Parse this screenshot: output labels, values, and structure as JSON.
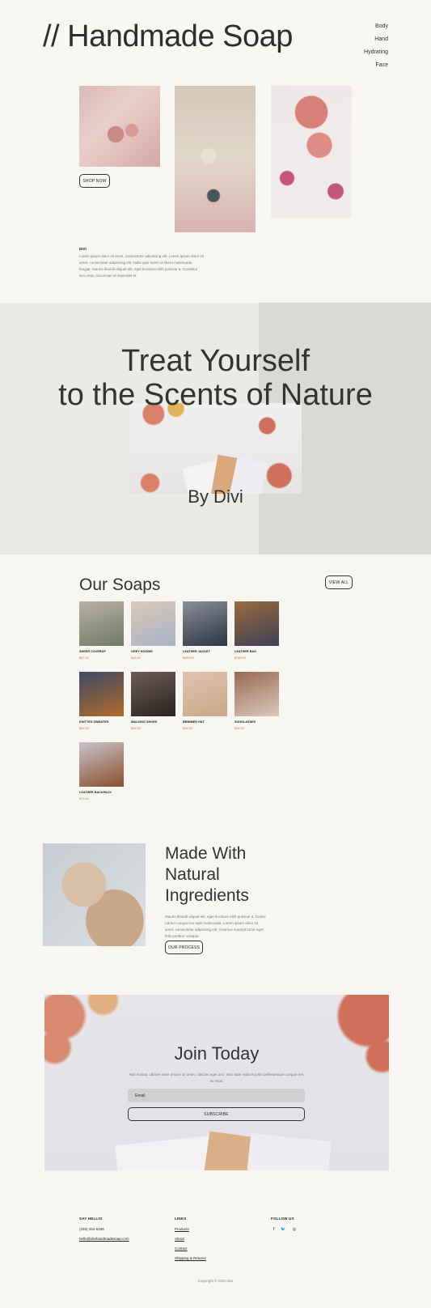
{
  "header": {
    "title": "// Handmade Soap",
    "nav": [
      "Body",
      "Hand",
      "Hydrating",
      "Face"
    ]
  },
  "intro": {
    "shop_button": "SHOP NOW",
    "blurb_title": "DIVI",
    "blurb_text": "Lorem ipsum dolor sit amet, consectetur adipiscing elit. Lorem ipsum dolor sit amet, consectetur adipiscing elit. Nulla quis lorem ut libero malesuada feugiat. Mauris blandit aliquet elit, eget tincidunt nibh pulvinar a. Curabitur arcu erat, accumsan id imperdiet et."
  },
  "hero": {
    "title_line1": "Treat Yourself",
    "title_line2": "to the Scents of Nature",
    "subtitle": "By Divi"
  },
  "soaps": {
    "title": "Our Soaps",
    "view_all": "VIEW ALL",
    "products": [
      {
        "name": "SHEER COVERUP",
        "price": "$57.00",
        "color1": "#6f7a64",
        "color2": "#b8b2a6"
      },
      {
        "name": "GREY HOODIE",
        "price": "$15.00",
        "color1": "#a8b3c6",
        "color2": "#d9c8b8"
      },
      {
        "name": "LEATHER JACKET",
        "price": "$289.00",
        "color1": "#2d3442",
        "color2": "#8a8f99"
      },
      {
        "name": "LEATHER BAG",
        "price": "$765.00",
        "color1": "#3b4256",
        "color2": "#9a6a3f"
      },
      {
        "name": "KNITTED SWEATER",
        "price": "$63.00",
        "color1": "#b26a2a",
        "color2": "#3d4a66"
      },
      {
        "name": "WALKING SHOES",
        "price": "$53.00",
        "color1": "#2a2320",
        "color2": "#6d5c55"
      },
      {
        "name": "BRIMMED HAT",
        "price": "$18.00",
        "color1": "#caa887",
        "color2": "#e2c2b0"
      },
      {
        "name": "SUNGLASSES",
        "price": "$46.00",
        "color1": "#d9c9be",
        "color2": "#9a6a52"
      },
      {
        "name": "LEATHER BACKPACK",
        "price": "$70.00",
        "color1": "#8a4f2c",
        "color2": "#c9c2cc"
      }
    ]
  },
  "ingredients": {
    "title": "Made With Natural Ingredients",
    "text": "Mauris blandit aliquet elit, eget tincidunt nibh pulvinar a. Donec rutrum congue leo eget malesuada. Lorem ipsum dolor sit amet, consectetur adipiscing elit. Vivamus suscipit tortor eget felis porttitor volutpat.",
    "button": "OUR PROCESS"
  },
  "join": {
    "title": "Join Today",
    "text": "Nisl massa, ultrices vitae ornare sit amet, ultricies eget orci. Sed vitae nulla et justo pellentesque congue nec eu risus.",
    "email_placeholder": "Email",
    "subscribe": "SUBSCRIBE"
  },
  "footer": {
    "say_hello": "SAY HELLO!",
    "phone": "(255) 352-6258",
    "email": "hello@divihandmadesoap.com",
    "links_title": "LINKS",
    "links": [
      "Products",
      "About",
      "Contact",
      "Shipping & Returns"
    ],
    "follow_title": "FOLLOW US",
    "social": [
      "f",
      "🐦",
      "◎"
    ],
    "copyright": "Copyright © 2022 Divi"
  },
  "colors": {
    "background": "#f7f6f2",
    "hero_left": "#ebebe6",
    "hero_right": "#dadad5",
    "price": "#c07a2a"
  }
}
